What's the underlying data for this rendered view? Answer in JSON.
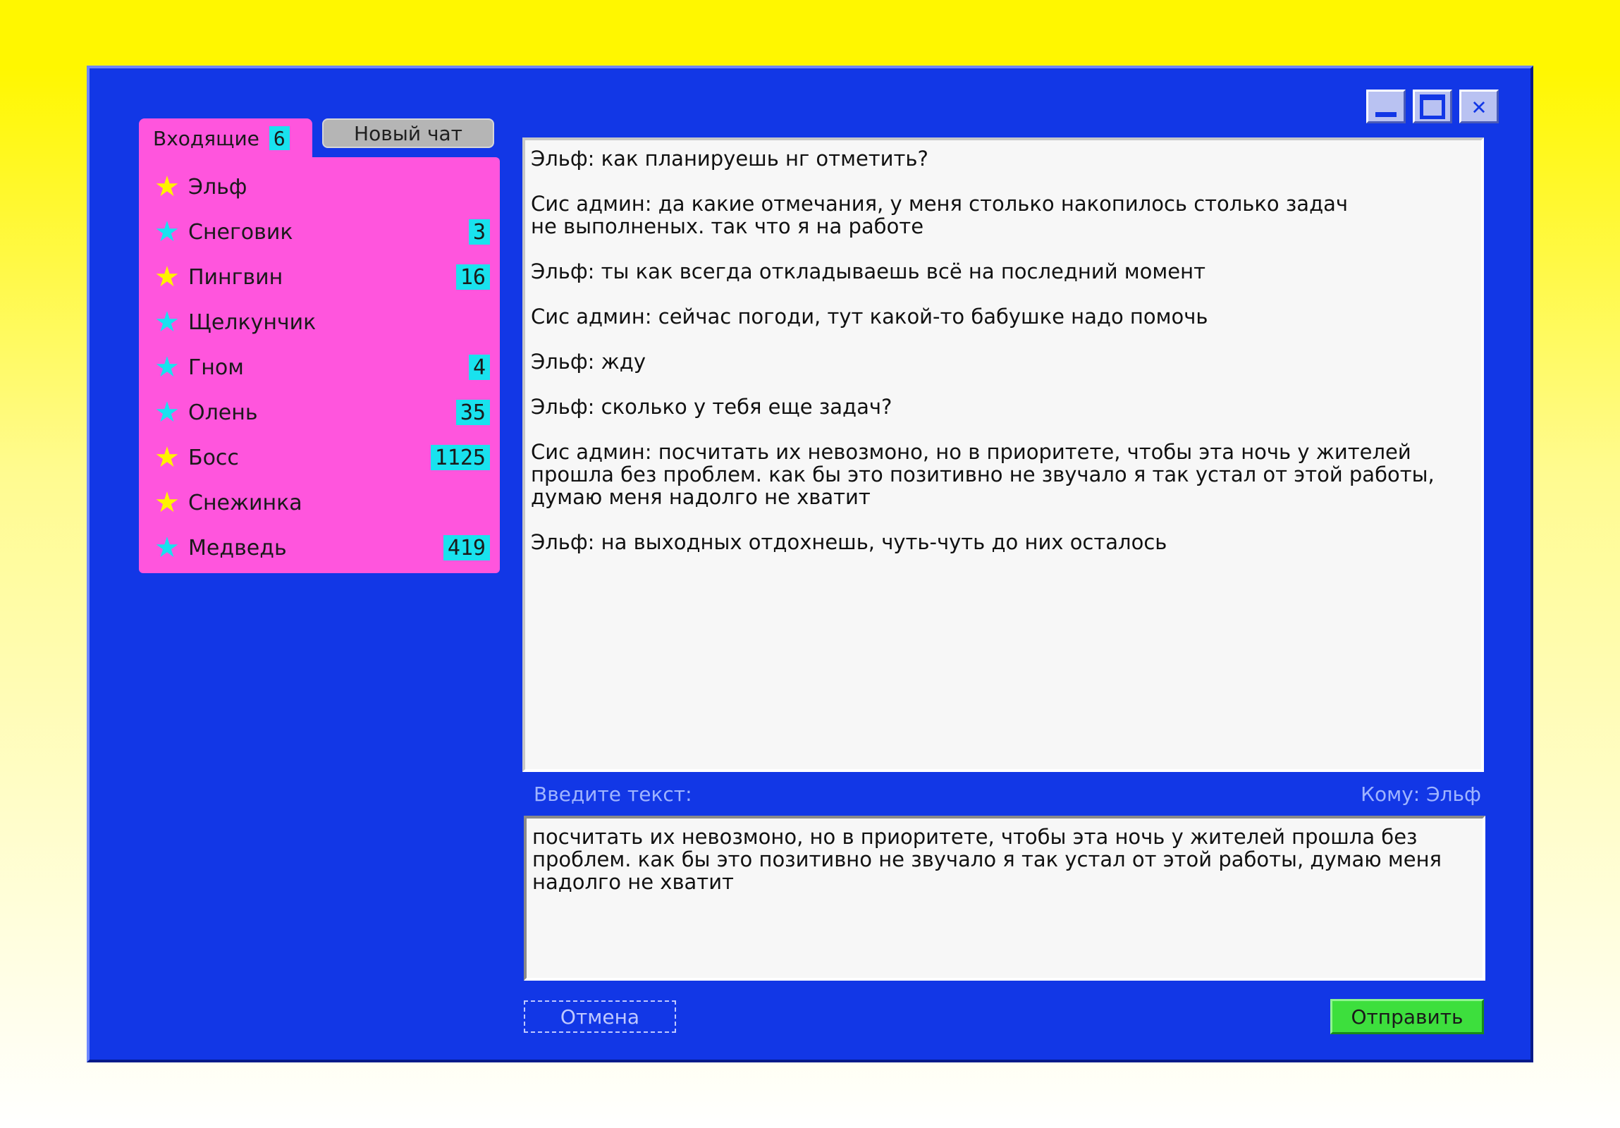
{
  "window": {
    "controls": {
      "minimize_icon": "minimize-icon",
      "maximize_icon": "maximize-icon",
      "close_icon": "close-icon"
    }
  },
  "tabs": {
    "inbox": {
      "label": "Входящие",
      "count": "6"
    },
    "new_chat": {
      "label": "Новый чат"
    }
  },
  "contacts": [
    {
      "name": "Эльф",
      "star": "yellow",
      "badge": ""
    },
    {
      "name": "Снеговик",
      "star": "cyan",
      "badge": "3"
    },
    {
      "name": "Пингвин",
      "star": "yellow",
      "badge": "16"
    },
    {
      "name": "Щелкунчик",
      "star": "cyan",
      "badge": ""
    },
    {
      "name": "Гном",
      "star": "cyan",
      "badge": "4"
    },
    {
      "name": "Олень",
      "star": "cyan",
      "badge": "35"
    },
    {
      "name": "Босс",
      "star": "yellow",
      "badge": "1125"
    },
    {
      "name": "Снежинка",
      "star": "yellow",
      "badge": ""
    },
    {
      "name": "Медведь",
      "star": "cyan",
      "badge": "419"
    }
  ],
  "messages": [
    "Эльф: как планируешь нг отметить?",
    "Сис админ: да какие отмечания, у меня столько накопилось столько задач\nне выполненых. так что я на работе",
    "Эльф: ты как всегда откладываешь всё на последний момент",
    "Сис админ: сейчас погоди, тут какой-то бабушке надо помочь",
    "Эльф: жду",
    "Эльф: сколько у тебя еще задач?",
    "Сис админ: посчитать их невозмоно, но в приоритете, чтобы эта ночь у жителей\nпрошла без проблем. как бы это позитивно не звучало я так устал от этой работы,\nдумаю меня надолго не хватит",
    "Эльф: на выходных отдохнешь, чуть-чуть до них осталось"
  ],
  "compose": {
    "label": "Введите текст:",
    "recipient": "Кому: Эльф",
    "value": "посчитать их невозмоно, но в приоритете, чтобы эта ночь у жителей прошла без\nпроблем. как бы это позитивно не звучало я так устал от этой работы, думаю меня\nнадолго не хватит"
  },
  "buttons": {
    "cancel": "Отмена",
    "send": "Отправить"
  },
  "colors": {
    "window_bg": "#1237e6",
    "sidebar_bg": "#ff55dd",
    "badge_bg": "#19e2ee",
    "send_bg": "#3ddf3d",
    "star_yellow": "#fff200",
    "star_cyan": "#19e2ee",
    "page_bg_top": "#fff700"
  }
}
